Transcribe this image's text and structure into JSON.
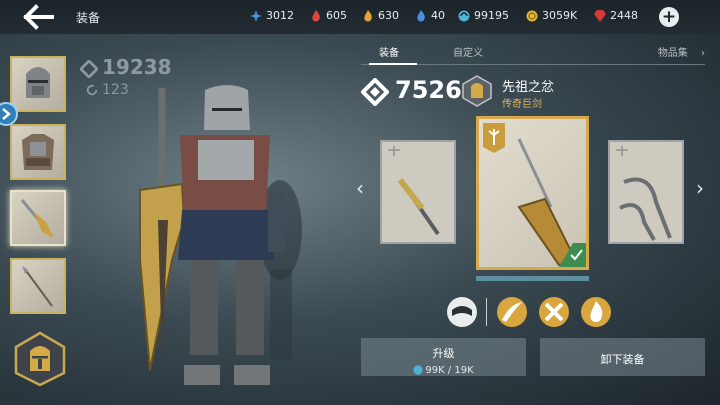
{
  "header": {
    "title": "装备",
    "resources": [
      {
        "icon": "blue-star-icon",
        "value": "3012",
        "color": "#4b8fd9"
      },
      {
        "icon": "red-flame-icon",
        "value": "605",
        "color": "#d9483b"
      },
      {
        "icon": "gold-flame-icon",
        "value": "630",
        "color": "#e0a532"
      },
      {
        "icon": "blue-flame-icon",
        "value": "40",
        "color": "#4a8fe0"
      },
      {
        "icon": "orb-icon",
        "value": "99195",
        "color": "#4fb1d6"
      },
      {
        "icon": "gold-coin-icon",
        "value": "3059K",
        "color": "#e5b637"
      },
      {
        "icon": "red-gem-icon",
        "value": "2448",
        "color": "#d93a33"
      }
    ]
  },
  "left": {
    "power": "19238",
    "sub_power": "123",
    "slots": [
      {
        "name": "helmet",
        "selected": false
      },
      {
        "name": "armor",
        "selected": false
      },
      {
        "name": "weapon",
        "selected": true
      },
      {
        "name": "ranged",
        "selected": false
      }
    ]
  },
  "tabs": {
    "equip": "装备",
    "custom": "自定义",
    "collection": "物品集"
  },
  "weapon": {
    "gear_score": "7526",
    "name": "先祖之忿",
    "rarity": "传奇巨剑"
  },
  "buttons": {
    "upgrade": "升级",
    "upgrade_cost": "99K / 19K",
    "unequip": "卸下装备"
  },
  "skills": [
    "shadow-skill-icon",
    "slash-skill-icon",
    "strike-skill-icon",
    "flame-skill-icon"
  ]
}
